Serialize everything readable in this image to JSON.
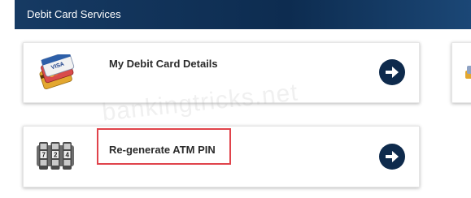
{
  "header": {
    "title": "Debit Card Services"
  },
  "cards": [
    {
      "label": "My Debit Card Details",
      "icon": "debit-cards-icon",
      "action_icon": "arrow-right-circle-icon"
    },
    {
      "label": "Re-generate ATM PIN",
      "icon": "pin-lock-icon",
      "action_icon": "arrow-right-circle-icon"
    }
  ],
  "watermark": "bankingtricks.net",
  "colors": {
    "header_bg": "#0d2c50",
    "arrow_button": "#0e2a4c",
    "highlight": "#e0434b"
  }
}
